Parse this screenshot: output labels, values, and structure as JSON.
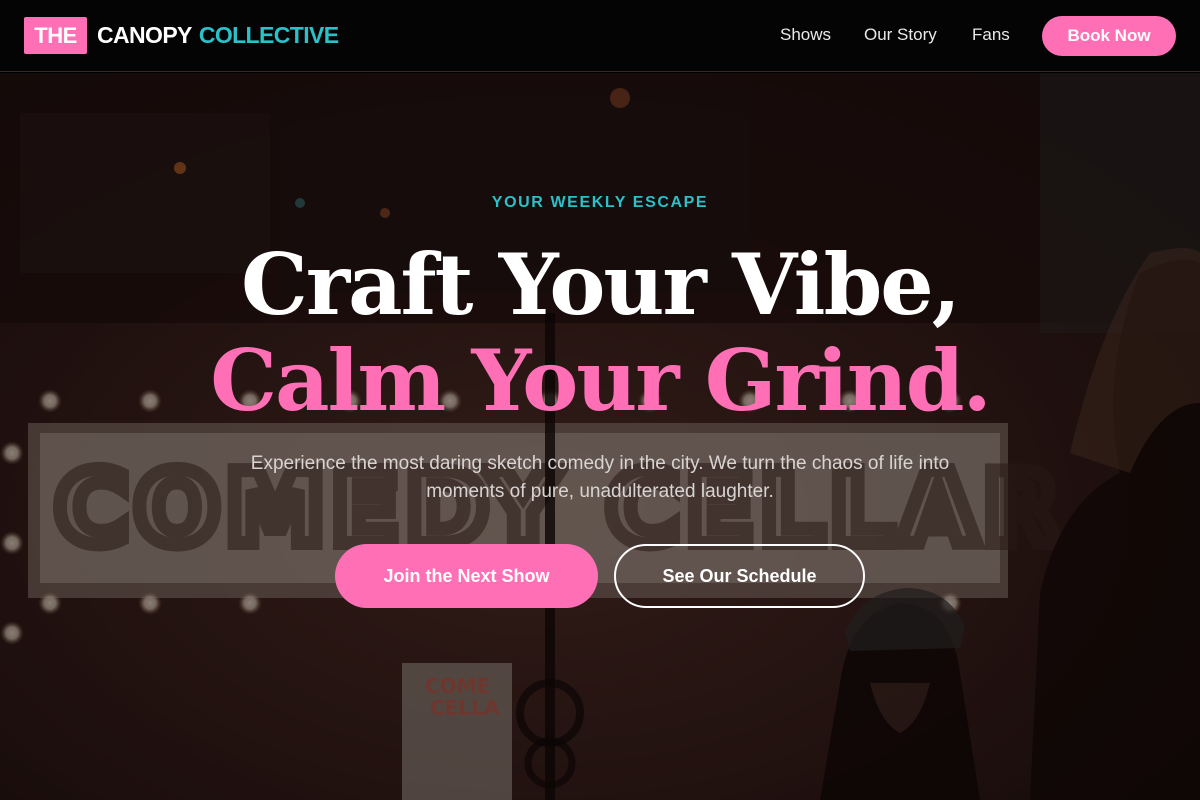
{
  "brand": {
    "badge": "THE",
    "word1": "CANOPY",
    "word2": "COLLECTIVE",
    "badge_color": "#ff6fb5",
    "accent_color": "#2ac1c8"
  },
  "nav": {
    "items": [
      {
        "label": "Shows"
      },
      {
        "label": "Our Story"
      },
      {
        "label": "Fans"
      }
    ],
    "cta_label": "Book Now"
  },
  "hero": {
    "eyebrow": "YOUR WEEKLY ESCAPE",
    "headline_line1": "Craft Your Vibe,",
    "headline_line2": "Calm Your Grind.",
    "subtext": "Experience the most daring sketch comedy in the city. We turn the chaos of life into moments of pure, unadulterated laughter.",
    "primary_cta": "Join the Next Show",
    "secondary_cta": "See Our Schedule",
    "background_sign_text": "COMEDY CELLAR",
    "background_sign_small": "COME CELLA"
  },
  "colors": {
    "pink": "#ff6fb5",
    "teal": "#2ac1c8",
    "header_bg": "#050404"
  }
}
